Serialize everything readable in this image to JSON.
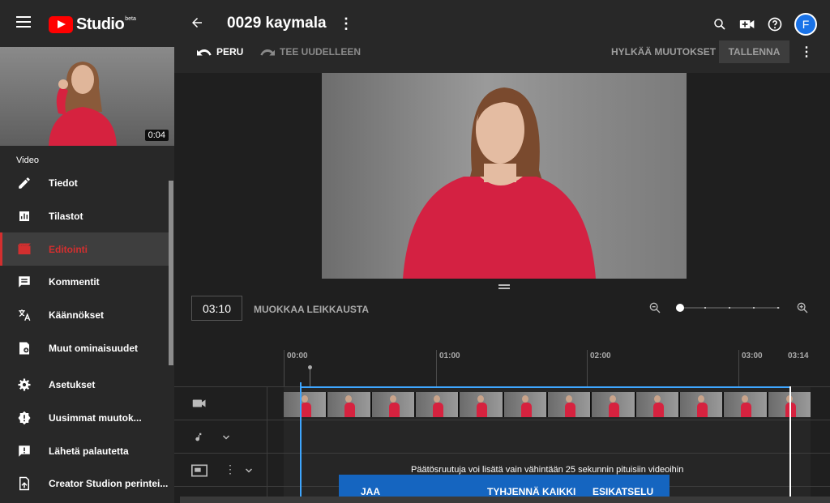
{
  "header": {
    "logo_text": "Studio",
    "logo_beta": "beta",
    "title": "0029 kaymala",
    "avatar_initial": "F"
  },
  "sidebar": {
    "thumbnail_duration": "0:04",
    "section_label": "Video",
    "items": [
      {
        "label": "Tiedot",
        "icon": "pencil-icon"
      },
      {
        "label": "Tilastot",
        "icon": "analytics-icon"
      },
      {
        "label": "Editointi",
        "icon": "editor-icon",
        "active": true
      },
      {
        "label": "Kommentit",
        "icon": "comment-icon"
      },
      {
        "label": "Käännökset",
        "icon": "translate-icon"
      },
      {
        "label": "Muut ominaisuudet",
        "icon": "more-features-icon"
      }
    ],
    "bottom_items": [
      {
        "label": "Asetukset",
        "icon": "gear-icon"
      },
      {
        "label": "Uusimmat muutok...",
        "icon": "warning-icon"
      },
      {
        "label": "Lähetä palautetta",
        "icon": "feedback-icon"
      },
      {
        "label": "Creator Studion perintei...",
        "icon": "classic-studio-icon"
      }
    ]
  },
  "toolbar": {
    "undo_label": "PERU",
    "redo_label": "TEE UUDELLEEN",
    "discard_label": "HYLKÄÄ MUUTOKSET",
    "save_label": "TALLENNA"
  },
  "timeline": {
    "current_time": "03:10",
    "trim_label": "MUOKKAA LEIKKAUSTA",
    "ruler": [
      "00:00",
      "01:00",
      "02:00",
      "03:00",
      "03:14"
    ],
    "end_screen_hint": "Päätösruutuja voi lisätä vain vähintään 25 sekunnin pituisiin videoihin"
  },
  "bottom_bar": {
    "share_label": "JAA",
    "clear_all_label": "TYHJENNÄ KAIKKI",
    "preview_label": "ESIKATSELU"
  },
  "colors": {
    "accent_red": "#d32f2f",
    "playhead_blue": "#3ea6ff",
    "action_bar_blue": "#1565c0"
  }
}
